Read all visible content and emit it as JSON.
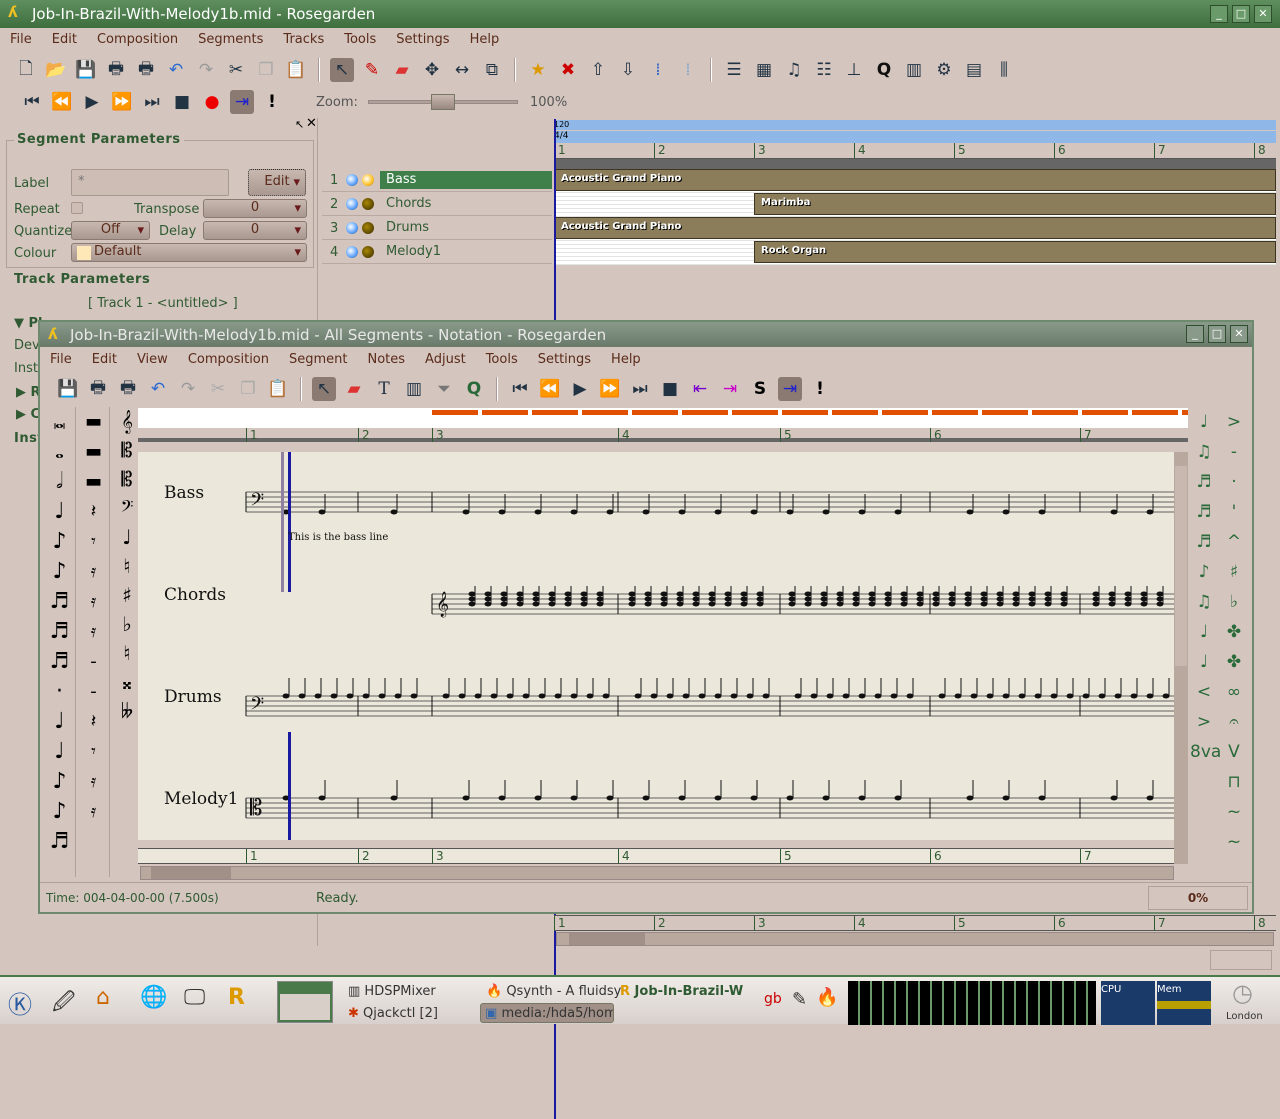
{
  "main": {
    "title": "Job-In-Brazil-With-Melody1b.mid - Rosegarden",
    "menu": [
      "File",
      "Edit",
      "Composition",
      "Segments",
      "Tracks",
      "Tools",
      "Settings",
      "Help"
    ],
    "zoom_label": "Zoom:",
    "zoom_value": "100%",
    "zoom_level_percent": 100
  },
  "segment_params": {
    "heading": "Segment Parameters",
    "label_label": "Label",
    "label_value": "*",
    "edit_button": "Edit",
    "repeat_label": "Repeat",
    "transpose_label": "Transpose",
    "transpose_value": "0",
    "quantize_label": "Quantize",
    "quantize_value": "Off",
    "delay_label": "Delay",
    "delay_value": "0",
    "colour_label": "Colour",
    "colour_value": "Default",
    "colour_swatch": "#ffe8b8"
  },
  "track_params": {
    "heading": "Track Parameters",
    "track_name": "[ Track 1 - <untitled> ]",
    "partial": [
      "Pl",
      "Dev",
      "Inst",
      "R",
      "C",
      "Inst"
    ]
  },
  "tracks": [
    {
      "num": "1",
      "name": "Bass",
      "selected": true
    },
    {
      "num": "2",
      "name": "Chords"
    },
    {
      "num": "3",
      "name": "Drums"
    },
    {
      "num": "4",
      "name": "Melody1"
    }
  ],
  "ruler": {
    "tempo": "120",
    "timesig": "4/4",
    "bars": [
      "1",
      "2",
      "3",
      "4",
      "5",
      "6",
      "7",
      "8"
    ]
  },
  "segments": [
    {
      "label": "Acoustic Grand Piano"
    },
    {
      "label": "Marimba"
    },
    {
      "label": "Acoustic Grand Piano"
    },
    {
      "label": "Rock Organ"
    }
  ],
  "notation": {
    "title": "Job-In-Brazil-With-Melody1b.mid - All Segments - Notation - Rosegarden",
    "menu": [
      "File",
      "Edit",
      "View",
      "Composition",
      "Segment",
      "Notes",
      "Adjust",
      "Tools",
      "Settings",
      "Help"
    ],
    "bars": [
      "1",
      "2",
      "3",
      "4",
      "5",
      "6",
      "7"
    ],
    "staves": [
      "Bass",
      "Chords",
      "Drums",
      "Melody1"
    ],
    "annotation": "This is the bass line",
    "status_time": "Time: 004-04-00-00 (7.500s)",
    "status_msg": "Ready.",
    "progress": "0%"
  },
  "taskbar": {
    "items": [
      "HDSPMixer",
      "Qsynth - A fluidsy",
      "Job-In-Brazil-W",
      "Qjackctl [2]",
      "media:/hda5/hom"
    ],
    "clock_label": "London",
    "cpu_label": "CPU",
    "mem_label": "Mem"
  },
  "colors": {
    "accent": "#3f7f4a",
    "title": "#4a7a4a",
    "segment": "#8b7d5a",
    "paper": "#ebe7da",
    "cursor": "#1a1aa0"
  }
}
